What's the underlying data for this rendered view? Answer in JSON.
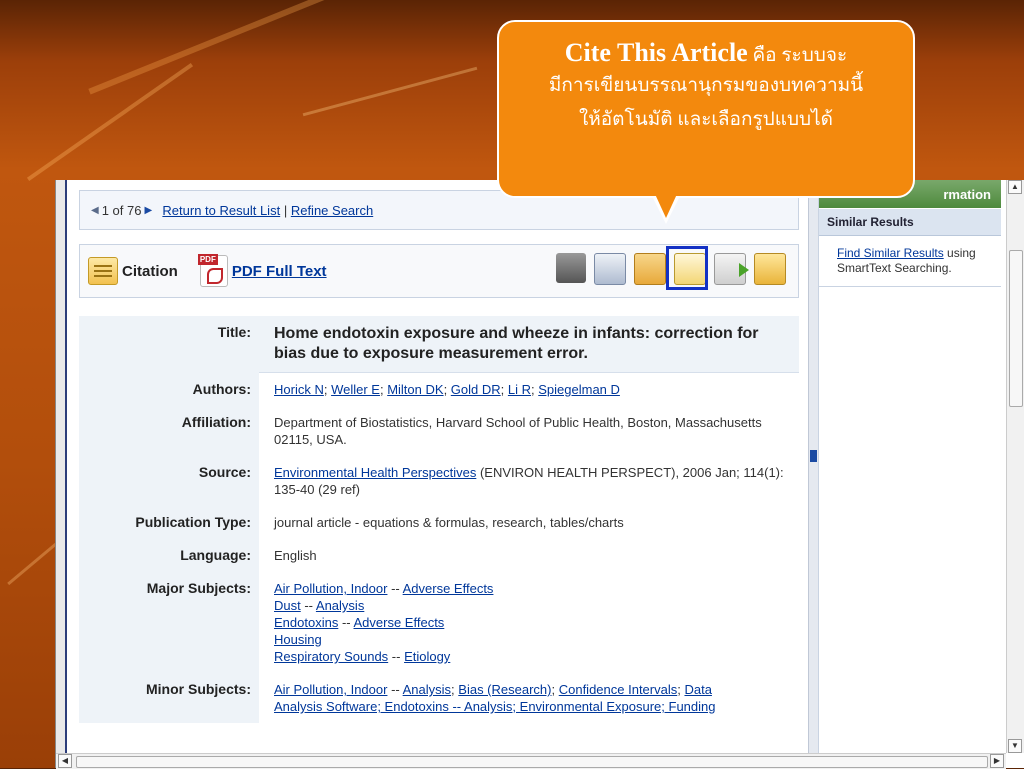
{
  "slide": {
    "callout": {
      "heading": "Cite This Article",
      "line1_rest": "คือ ระบบจะ",
      "line2": "มีการเขียนบรรณานุกรมของบทความนี้",
      "line3": "ให้อัตโนมัติ และเลือกรูปแบบได้"
    }
  },
  "nav": {
    "position": "1 of 76",
    "return_link": "Return to Result List",
    "separator": "|",
    "refine_link": "Refine Search"
  },
  "toolbar": {
    "citation_label": "Citation",
    "pdf_label": "PDF Full Text",
    "icons": [
      "print-icon",
      "email-icon",
      "save-icon",
      "cite-icon",
      "export-icon",
      "folder-icon"
    ]
  },
  "record": {
    "title": {
      "label": "Title:",
      "value": "Home endotoxin exposure and wheeze in infants: correction for bias due to exposure measurement error."
    },
    "authors": {
      "label": "Authors:",
      "values": [
        "Horick N",
        "Weller E",
        "Milton DK",
        "Gold DR",
        "Li R",
        "Spiegelman D"
      ]
    },
    "affiliation": {
      "label": "Affiliation:",
      "value": "Department of Biostatistics, Harvard School of Public Health, Boston, Massachusetts 02115, USA."
    },
    "source": {
      "label": "Source:",
      "journal": "Environmental Health Perspectives",
      "rest": "(ENVIRON HEALTH PERSPECT), 2006 Jan; 114(1): 135-40 (29 ref)"
    },
    "pubtype": {
      "label": "Publication Type:",
      "value": "journal article - equations & formulas, research, tables/charts"
    },
    "language": {
      "label": "Language:",
      "value": "English"
    },
    "major": {
      "label": "Major Subjects:",
      "lines": [
        [
          "Air Pollution, Indoor",
          "Adverse Effects"
        ],
        [
          "Dust",
          "Analysis"
        ],
        [
          "Endotoxins",
          "Adverse Effects"
        ],
        [
          "Housing"
        ],
        [
          "Respiratory Sounds",
          "Etiology"
        ]
      ]
    },
    "minor": {
      "label": "Minor Subjects:",
      "line1": [
        "Air Pollution, Indoor",
        "Analysis",
        "Bias (Research)",
        "Confidence Intervals",
        "Data"
      ],
      "line2": "Analysis Software; Endotoxins -- Analysis; Environmental Exposure; Funding"
    }
  },
  "right_panel": {
    "header": "rmation",
    "subheader": "Similar Results",
    "link": "Find Similar Results",
    "text": "using SmartText Searching."
  },
  "colors": {
    "link": "#00379a",
    "callout": "#f3890d",
    "highlight": "#1331c4",
    "panel_green": "#4e8a3d"
  }
}
